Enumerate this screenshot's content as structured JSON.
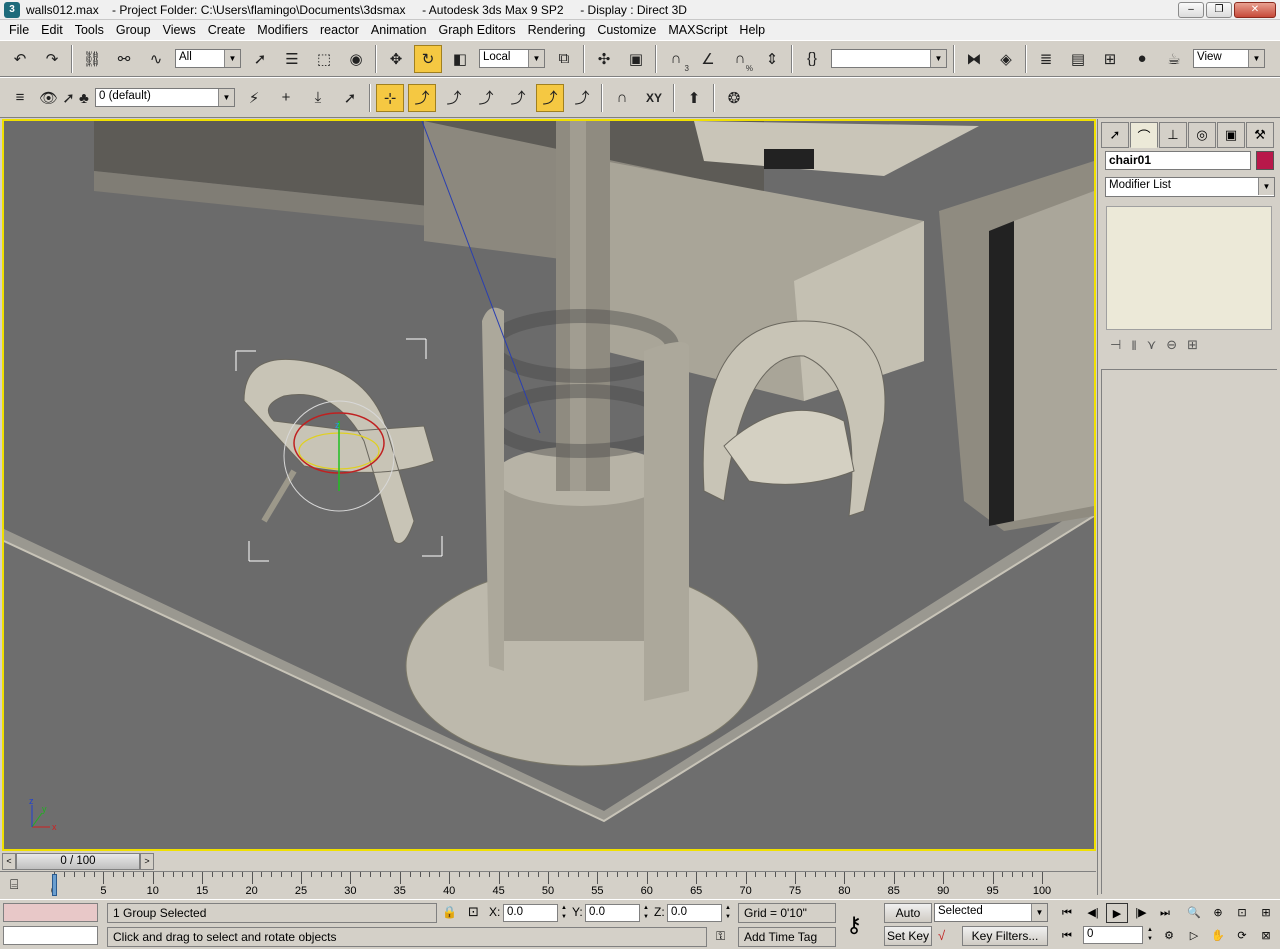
{
  "window": {
    "title": "walls012.max    - Project Folder: C:\\Users\\flamingo\\Documents\\3dsmax     - Autodesk 3ds Max 9 SP2     - Display : Direct 3D",
    "minimize": "–",
    "maximize": "❐",
    "close": "✕"
  },
  "menu": [
    "File",
    "Edit",
    "Tools",
    "Group",
    "Views",
    "Create",
    "Modifiers",
    "reactor",
    "Animation",
    "Graph Editors",
    "Rendering",
    "Customize",
    "MAXScript",
    "Help"
  ],
  "toolbar": {
    "selection_filter": "All",
    "reference_coord": "Local",
    "named_selection": "",
    "viewport_label": "View",
    "layer_name": "0 (default)",
    "xy_label": "XY",
    "snap_label": "3",
    "angle_label": "%"
  },
  "command_panel": {
    "object_name": "chair01",
    "object_color": "#b8184a",
    "modifier_list": "Modifier List"
  },
  "time_slider": {
    "frame_label": "0 / 100",
    "prev": "<",
    "next": ">"
  },
  "trackbar": {
    "ticks": [
      "0",
      "5",
      "10",
      "15",
      "20",
      "25",
      "30",
      "35",
      "40",
      "45",
      "50",
      "55",
      "60",
      "65",
      "70",
      "75",
      "80",
      "85",
      "90",
      "95",
      "100"
    ]
  },
  "status": {
    "selection_info": "1 Group Selected",
    "prompt": "Click and drag to select and rotate objects",
    "x_label": "X:",
    "y_label": "Y:",
    "z_label": "Z:",
    "x_value": "0.0",
    "y_value": "0.0",
    "z_value": "0.0",
    "grid": "Grid = 0'10\"",
    "add_time_tag": "Add Time Tag",
    "auto_key": "Auto Key",
    "set_key": "Set Key",
    "key_mode": "Selected",
    "key_filters": "Key Filters...",
    "current_frame": "0"
  },
  "viewport": {
    "axis_x": "x",
    "axis_y": "y",
    "axis_z": "z",
    "gizmo_z": "z"
  }
}
